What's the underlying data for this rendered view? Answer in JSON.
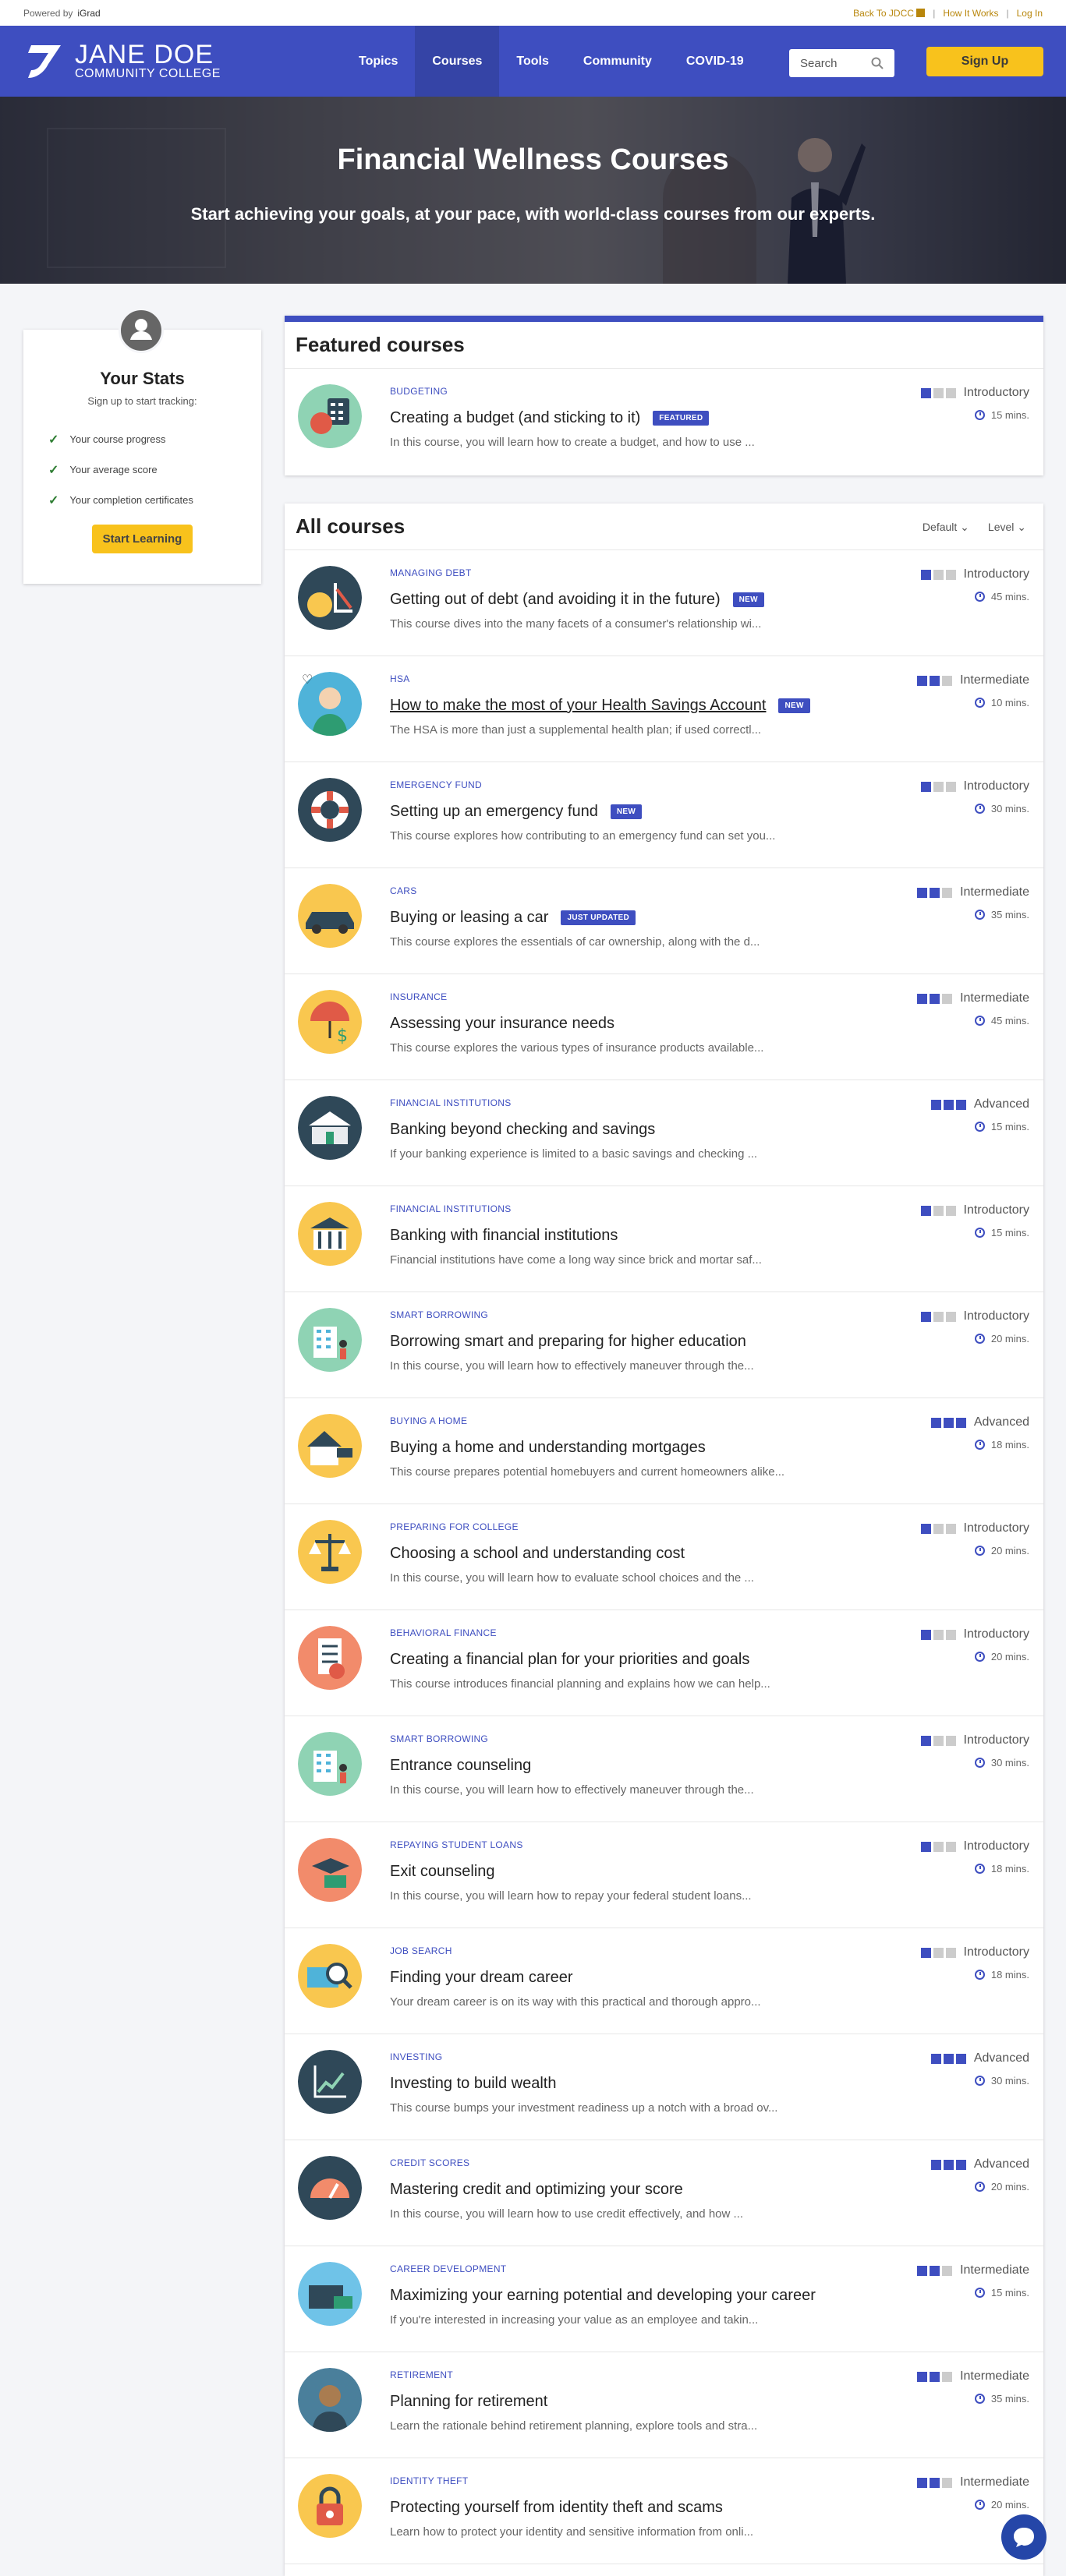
{
  "topbar": {
    "powered_by": "Powered by",
    "brand": "iGrad",
    "back_link": "Back To JDCC",
    "how_link": "How It Works",
    "login_link": "Log In"
  },
  "header": {
    "logo_line1": "JANE DOE",
    "logo_line2": "COMMUNITY COLLEGE",
    "nav": [
      {
        "label": "Topics"
      },
      {
        "label": "Courses"
      },
      {
        "label": "Tools"
      },
      {
        "label": "Community"
      },
      {
        "label": "COVID-19"
      }
    ],
    "search_placeholder": "Search",
    "signup": "Sign Up",
    "accent": "#3e4ec0",
    "button_color": "#f8c21c"
  },
  "hero": {
    "title": "Financial Wellness Courses",
    "subtitle": "Start achieving your goals, at your pace, with world-class courses from our experts."
  },
  "stats": {
    "title": "Your Stats",
    "subtitle": "Sign up to start tracking:",
    "items": [
      "Your course progress",
      "Your average score",
      "Your completion certificates"
    ],
    "button": "Start Learning"
  },
  "featured": {
    "heading": "Featured courses",
    "course": {
      "category": "Budgeting",
      "title": "Creating a budget (and sticking to it)",
      "badge": "FEATURED",
      "desc": "In this course, you will learn how to create a budget, and how to use ...",
      "level": "Introductory",
      "level_num": 1,
      "duration": "15 mins.",
      "icon": "budget-icon",
      "icon_bg": "#8fd3b4"
    }
  },
  "all": {
    "heading": "All courses",
    "sort_default": "Default",
    "sort_level": "Level",
    "courses": [
      {
        "category": "Managing Debt",
        "title": "Getting out of debt (and avoiding it in the future)",
        "badge": "NEW",
        "desc": "This course dives into the many facets of a consumer's relationship wi...",
        "level": "Introductory",
        "level_num": 1,
        "duration": "45 mins.",
        "icon": "debt-icon",
        "icon_bg": "#2f4858"
      },
      {
        "category": "HSA",
        "title": "How to make the most of your Health Savings Account",
        "badge": "NEW",
        "desc": "The HSA is more than just a supplemental health plan; if used correctl...",
        "level": "Intermediate",
        "level_num": 2,
        "duration": "10 mins.",
        "icon": "health-savings-icon",
        "icon_bg": "#4fb3d9"
      },
      {
        "category": "Emergency Fund",
        "title": "Setting up an emergency fund",
        "badge": "NEW",
        "desc": "This course explores how contributing to an emergency fund can set you...",
        "level": "Introductory",
        "level_num": 1,
        "duration": "30 mins.",
        "icon": "lifebuoy-icon",
        "icon_bg": "#2f4858"
      },
      {
        "category": "Cars",
        "title": "Buying or leasing a car",
        "badge": "JUST UPDATED",
        "desc": "This course explores the essentials of car ownership, along with the d...",
        "level": "Intermediate",
        "level_num": 2,
        "duration": "35 mins.",
        "icon": "car-icon",
        "icon_bg": "#f9c74f"
      },
      {
        "category": "Insurance",
        "title": "Assessing your insurance needs",
        "badge": "",
        "desc": "This course explores the various types of insurance products available...",
        "level": "Intermediate",
        "level_num": 2,
        "duration": "45 mins.",
        "icon": "umbrella-icon",
        "icon_bg": "#f9c74f"
      },
      {
        "category": "Financial Institutions",
        "title": "Banking beyond checking and savings",
        "badge": "",
        "desc": "If your banking experience is limited to a basic savings and checking ...",
        "level": "Advanced",
        "level_num": 3,
        "duration": "15 mins.",
        "icon": "bank-icon",
        "icon_bg": "#2f4858"
      },
      {
        "category": "Financial Institutions",
        "title": "Banking with financial institutions",
        "badge": "",
        "desc": "Financial institutions have come a long way since brick and mortar saf...",
        "level": "Introductory",
        "level_num": 1,
        "duration": "15 mins.",
        "icon": "bank-building-icon",
        "icon_bg": "#f9c74f"
      },
      {
        "category": "Smart Borrowing",
        "title": "Borrowing smart and preparing for higher education",
        "badge": "",
        "desc": "In this course, you will learn how to effectively maneuver through the...",
        "level": "Introductory",
        "level_num": 1,
        "duration": "20 mins.",
        "icon": "campus-icon",
        "icon_bg": "#8fd3b4"
      },
      {
        "category": "Buying a Home",
        "title": "Buying a home and understanding mortgages",
        "badge": "",
        "desc": "This course prepares potential homebuyers and current homeowners alike...",
        "level": "Advanced",
        "level_num": 3,
        "duration": "18 mins.",
        "icon": "house-icon",
        "icon_bg": "#f9c74f"
      },
      {
        "category": "Preparing for College",
        "title": "Choosing a school and understanding cost",
        "badge": "",
        "desc": "In this course, you will learn how to evaluate school choices and the ...",
        "level": "Introductory",
        "level_num": 1,
        "duration": "20 mins.",
        "icon": "scale-icon",
        "icon_bg": "#f9c74f"
      },
      {
        "category": "Behavioral Finance",
        "title": "Creating a financial plan for your priorities and goals",
        "badge": "",
        "desc": "This course introduces financial planning and explains how we can help...",
        "level": "Introductory",
        "level_num": 1,
        "duration": "20 mins.",
        "icon": "checklist-icon",
        "icon_bg": "#f28b6b"
      },
      {
        "category": "Smart Borrowing",
        "title": "Entrance counseling",
        "badge": "",
        "desc": "In this course, you will learn how to effectively maneuver through the...",
        "level": "Introductory",
        "level_num": 1,
        "duration": "30 mins.",
        "icon": "campus-icon",
        "icon_bg": "#8fd3b4"
      },
      {
        "category": "Repaying Student Loans",
        "title": "Exit counseling",
        "badge": "",
        "desc": "In this course, you will learn how to repay your federal student loans...",
        "level": "Introductory",
        "level_num": 1,
        "duration": "18 mins.",
        "icon": "graduation-money-icon",
        "icon_bg": "#f28b6b"
      },
      {
        "category": "Job Search",
        "title": "Finding your dream career",
        "badge": "",
        "desc": "Your dream career is on its way with this practical and thorough appro...",
        "level": "Introductory",
        "level_num": 1,
        "duration": "18 mins.",
        "icon": "magnifier-icon",
        "icon_bg": "#f9c74f"
      },
      {
        "category": "Investing",
        "title": "Investing to build wealth",
        "badge": "",
        "desc": "This course bumps your investment readiness up a notch with a broad ov...",
        "level": "Advanced",
        "level_num": 3,
        "duration": "30 mins.",
        "icon": "growth-chart-icon",
        "icon_bg": "#2f4858"
      },
      {
        "category": "Credit Scores",
        "title": "Mastering credit and optimizing your score",
        "badge": "",
        "desc": "In this course, you will learn how to use credit effectively, and how ...",
        "level": "Advanced",
        "level_num": 3,
        "duration": "20 mins.",
        "icon": "gauge-icon",
        "icon_bg": "#2f4858"
      },
      {
        "category": "Career Development",
        "title": "Maximizing your earning potential and developing your career",
        "badge": "",
        "desc": "If you're interested in increasing your value as an employee and takin...",
        "level": "Intermediate",
        "level_num": 2,
        "duration": "15 mins.",
        "icon": "briefcase-icon",
        "icon_bg": "#6fc3e8"
      },
      {
        "category": "Retirement",
        "title": "Planning for retirement",
        "badge": "",
        "desc": "Learn the rationale behind retirement planning, explore tools and stra...",
        "level": "Intermediate",
        "level_num": 2,
        "duration": "35 mins.",
        "icon": "retiree-icon",
        "icon_bg": "#4a7f9b"
      },
      {
        "category": "Identity Theft",
        "title": "Protecting yourself from identity theft and scams",
        "badge": "",
        "desc": "Learn how to protect your identity and sensitive information from onli...",
        "level": "Intermediate",
        "level_num": 2,
        "duration": "20 mins.",
        "icon": "padlock-icon",
        "icon_bg": "#f9c74f"
      }
    ]
  }
}
